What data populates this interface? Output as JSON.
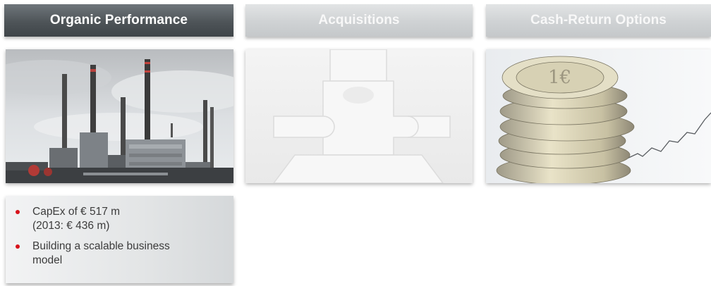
{
  "columns": [
    {
      "title": "Organic Performance",
      "image_icon": "industrial-plant-photo",
      "bullets": [
        "CapEx of € 517 m\n(2013: € 436 m)",
        "Building a scalable business\nmodel"
      ]
    },
    {
      "title": "Acquisitions",
      "image_icon": "puzzle-pieces-photo"
    },
    {
      "title": "Cash-Return Options",
      "image_icon": "euro-coin-stack-photo"
    }
  ],
  "colors": {
    "header_active": "#4e5458",
    "header_inactive": "#cfd2d4",
    "bullet_red": "#d7131b"
  }
}
